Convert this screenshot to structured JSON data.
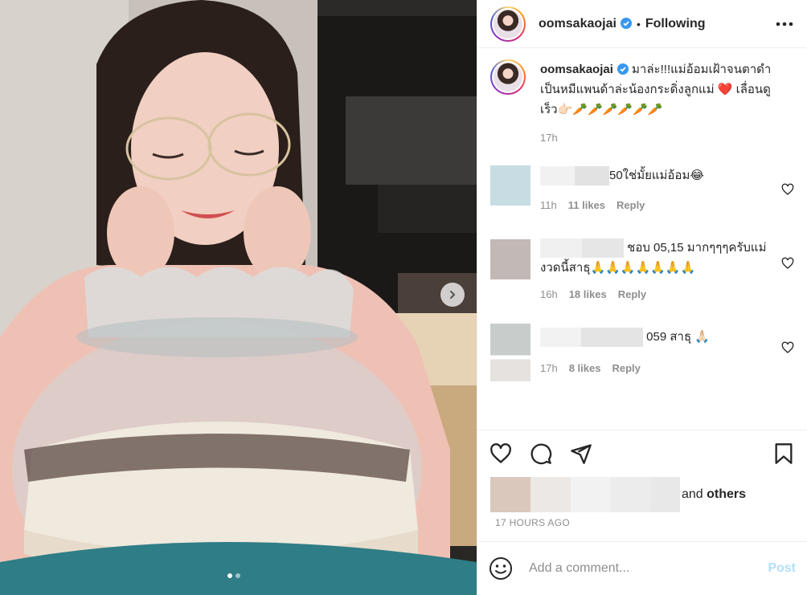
{
  "post": {
    "username": "oomsakaojai",
    "separator": "•",
    "follow_status": "Following",
    "caption_text": "มาล่ะ!!!แม่อ้อมเฝ้าจนตาดำเป็นหมีแพนด้าล่ะน้องกระดิ่งลูกแม่ ❤️ เลื่อนดูเร็ว👉🏻🥕🥕🥕🥕🥕🥕",
    "caption_time": "17h",
    "liked_by_suffix": "and",
    "liked_by_others": "others",
    "posted_ago": "17 HOURS AGO"
  },
  "comments": [
    {
      "text": "50ใช่มั้ยแม่อ้อม😂",
      "time": "11h",
      "likes": "11 likes",
      "reply": "Reply"
    },
    {
      "text": "ชอบ 05,15 มากๆๆๆครับแม่งวดนี้สาธุ🙏🙏🙏🙏🙏🙏🙏",
      "time": "16h",
      "likes": "18 likes",
      "reply": "Reply"
    },
    {
      "text": "059 สาธุ 🙏🏻",
      "time": "17h",
      "likes": "8 likes",
      "reply": "Reply"
    }
  ],
  "composer": {
    "placeholder": "Add a comment...",
    "post_label": "Post"
  },
  "carousel": {
    "slide_count": 2,
    "active_index": 0
  },
  "icons": {
    "more": "more-horizontal-icon",
    "verified": "verified-badge-icon",
    "heart": "heart-icon",
    "comment": "comment-icon",
    "share": "share-icon",
    "save": "bookmark-icon",
    "emoji": "emoji-icon",
    "next": "chevron-right-icon"
  },
  "colors": {
    "verified": "#3897f0",
    "post_disabled": "#b2dffc",
    "muted": "#8e8e8e"
  }
}
